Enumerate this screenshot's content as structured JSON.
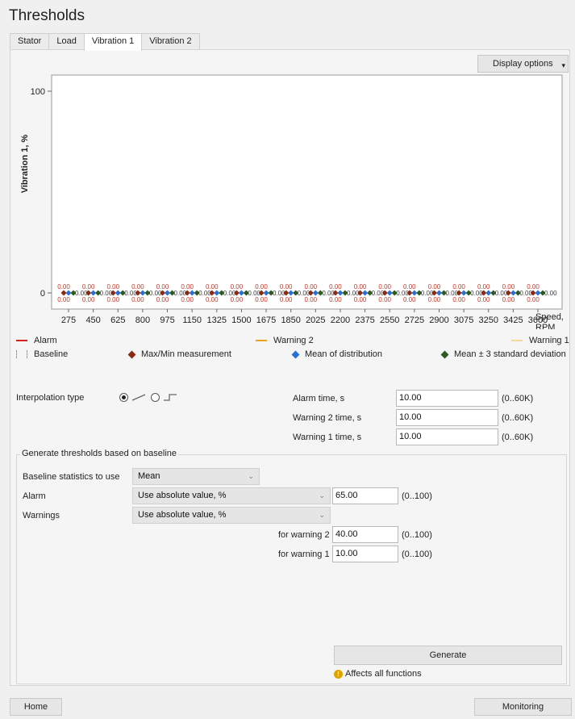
{
  "page_title": "Thresholds",
  "tabs": [
    "Stator",
    "Load",
    "Vibration 1",
    "Vibration 2"
  ],
  "active_tab": "Vibration 1",
  "display_options_label": "Display options",
  "chart_data": {
    "type": "scatter",
    "ylabel": "Vibration 1, %",
    "xlabel": "Speed, RPM",
    "ylim": [
      0,
      100
    ],
    "y_ticks": [
      "100",
      "0"
    ],
    "categories": [
      "275",
      "450",
      "625",
      "800",
      "975",
      "1150",
      "1325",
      "1500",
      "1675",
      "1850",
      "2025",
      "2200",
      "2375",
      "2550",
      "2725",
      "2900",
      "3075",
      "3250",
      "3425",
      "3600"
    ],
    "series": [
      {
        "name": "Max/Min measurement",
        "color": "#8b2a10",
        "values": [
          0,
          0,
          0,
          0,
          0,
          0,
          0,
          0,
          0,
          0,
          0,
          0,
          0,
          0,
          0,
          0,
          0,
          0,
          0,
          0
        ]
      },
      {
        "name": "Mean of distribution",
        "color": "#2a6fd6",
        "values": [
          0,
          0,
          0,
          0,
          0,
          0,
          0,
          0,
          0,
          0,
          0,
          0,
          0,
          0,
          0,
          0,
          0,
          0,
          0,
          0
        ]
      },
      {
        "name": "Mean ± 3 standard deviation",
        "color": "#2f5a1f",
        "values": [
          0,
          0,
          0,
          0,
          0,
          0,
          0,
          0,
          0,
          0,
          0,
          0,
          0,
          0,
          0,
          0,
          0,
          0,
          0,
          0
        ]
      }
    ],
    "point_label": "0.00"
  },
  "legend": {
    "alarm": "Alarm",
    "warning2": "Warning 2",
    "warning1": "Warning 1",
    "baseline": "Baseline",
    "maxmin": "Max/Min measurement",
    "mean": "Mean of distribution",
    "std": "Mean ± 3 standard deviation"
  },
  "colors": {
    "alarm": "#d42020",
    "warning2": "#f0a020",
    "warning1": "#f7d89a",
    "maxmin": "#8b2a10",
    "mean": "#2a6fd6",
    "std": "#2f5a1f"
  },
  "interpolation": {
    "label": "Interpolation type",
    "selected": "linear"
  },
  "times": [
    {
      "label": "Alarm time, s",
      "value": "10.00",
      "range": "(0..60K)"
    },
    {
      "label": "Warning 2 time, s",
      "value": "10.00",
      "range": "(0..60K)"
    },
    {
      "label": "Warning 1 time, s",
      "value": "10.00",
      "range": "(0..60K)"
    }
  ],
  "generate": {
    "group_title": "Generate thresholds based on baseline",
    "stats_label": "Baseline statistics to use",
    "stats_value": "Mean",
    "alarm_label": "Alarm",
    "alarm_mode": "Use absolute value, %",
    "alarm_value": "65.00",
    "alarm_range": "(0..100)",
    "warnings_label": "Warnings",
    "warnings_mode": "Use absolute value, %",
    "w2_label": "for warning 2",
    "w2_value": "40.00",
    "w2_range": "(0..100)",
    "w1_label": "for warning 1",
    "w1_value": "10.00",
    "w1_range": "(0..100)",
    "button": "Generate",
    "note": "Affects all functions"
  },
  "footer": {
    "home": "Home",
    "monitoring": "Monitoring"
  }
}
